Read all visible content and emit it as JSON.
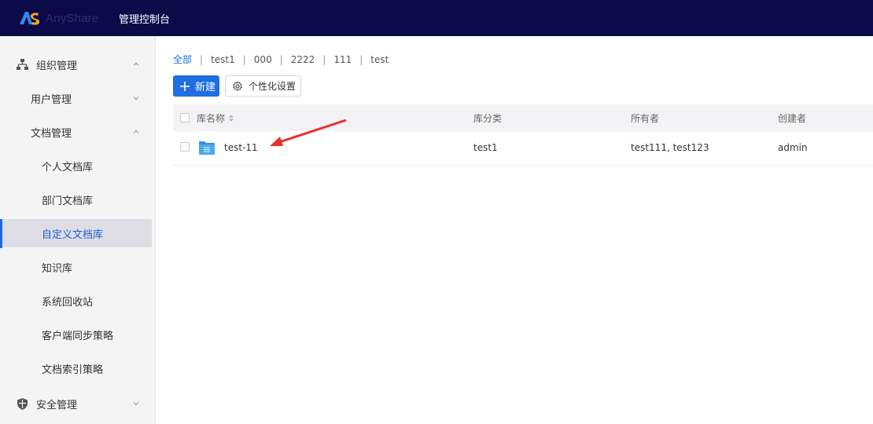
{
  "topbar": {
    "brand": "AnyShare",
    "console_title": "管理控制台"
  },
  "sidebar": {
    "items": [
      {
        "label": "组织管理",
        "icon": "org-tree-icon",
        "level": 0,
        "expanded": true
      },
      {
        "label": "用户管理",
        "level": 1,
        "expanded": false
      },
      {
        "label": "文档管理",
        "level": 1,
        "expanded": true
      },
      {
        "label": "个人文档库",
        "level": 2
      },
      {
        "label": "部门文档库",
        "level": 2
      },
      {
        "label": "自定义文档库",
        "level": 2,
        "active": true
      },
      {
        "label": "知识库",
        "level": 2
      },
      {
        "label": "系统回收站",
        "level": 2
      },
      {
        "label": "客户端同步策略",
        "level": 2
      },
      {
        "label": "文档索引策略",
        "level": 2
      },
      {
        "label": "安全管理",
        "icon": "shield-icon",
        "level": 0,
        "expanded": false
      }
    ]
  },
  "breadcrumb": [
    "全部",
    "test1",
    "000",
    "2222",
    "111",
    "test"
  ],
  "toolbar": {
    "new_label": "新建",
    "custom_label": "个性化设置"
  },
  "table": {
    "columns": [
      "库名称",
      "库分类",
      "所有者",
      "创建者"
    ],
    "rows": [
      {
        "name": "test-11",
        "category": "test1",
        "owners": "test111, test123",
        "creator": "admin"
      }
    ]
  },
  "colors": {
    "topbar_bg": "#0d0a4a",
    "accent": "#1f6fe0",
    "annotation_arrow": "#e8302a"
  }
}
